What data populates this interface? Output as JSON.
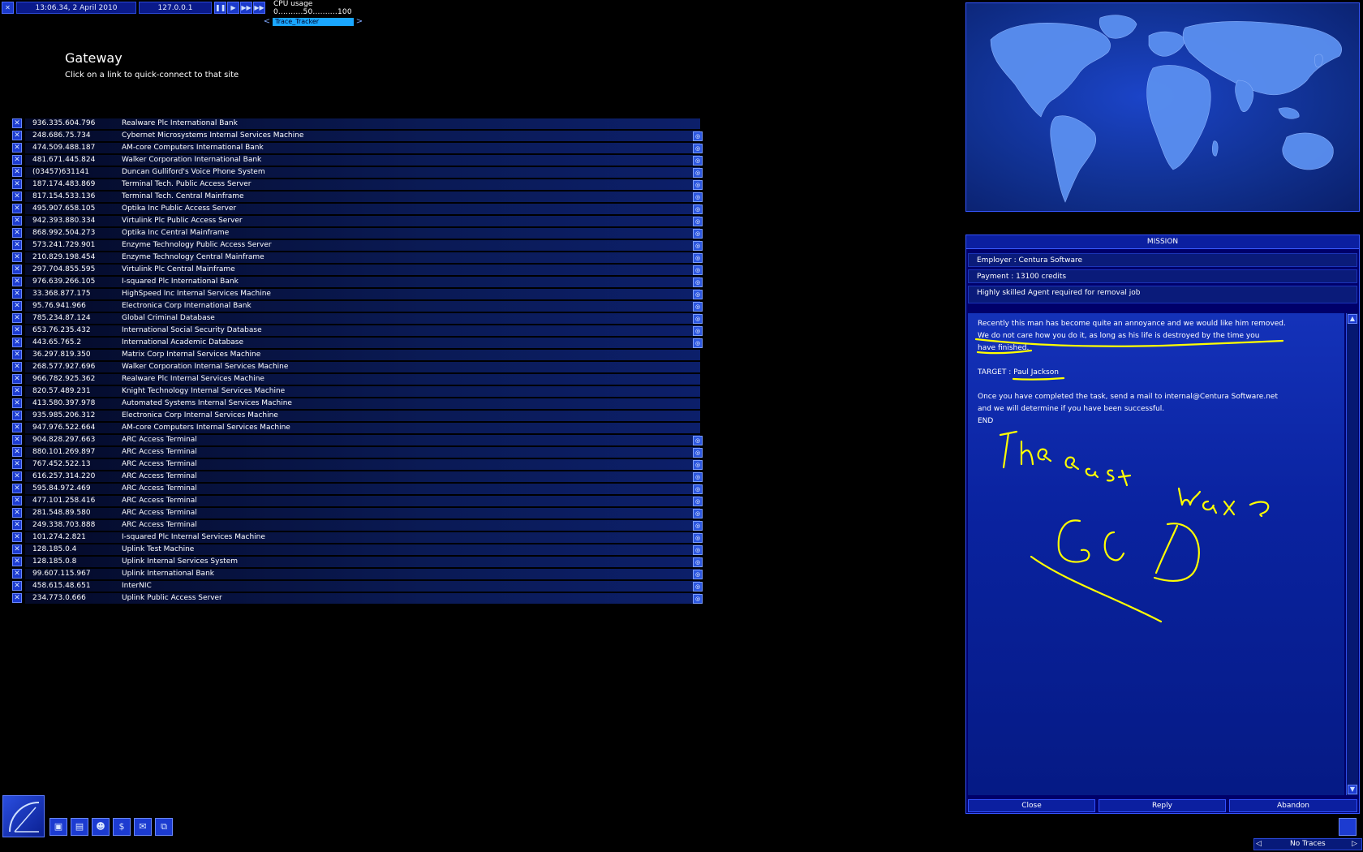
{
  "topbar": {
    "close_icon": "x",
    "datetime": "13:06.34, 2 April 2010",
    "ip": "127.0.0.1",
    "speed_buttons": [
      "pause",
      "play",
      "fast",
      "faster"
    ],
    "cpu_label": "CPU usage",
    "cpu_scale": "0..........50..........100",
    "tracker_name": "Trace_Tracker"
  },
  "gateway": {
    "title": "Gateway",
    "subtitle": "Click on a link to quick-connect to that site"
  },
  "links": [
    {
      "ip": "936.335.604.796",
      "name": "Realware Plc International Bank",
      "bookmark": false
    },
    {
      "ip": "248.686.75.734",
      "name": "Cybernet Microsystems Internal Services Machine",
      "bookmark": true
    },
    {
      "ip": "474.509.488.187",
      "name": "AM-core Computers International Bank",
      "bookmark": true
    },
    {
      "ip": "481.671.445.824",
      "name": "Walker Corporation International Bank",
      "bookmark": true
    },
    {
      "ip": "(03457)631141",
      "name": "Duncan Gulliford's Voice Phone System",
      "bookmark": true
    },
    {
      "ip": "187.174.483.869",
      "name": "Terminal Tech. Public Access Server",
      "bookmark": true
    },
    {
      "ip": "817.154.533.136",
      "name": "Terminal Tech. Central Mainframe",
      "bookmark": true
    },
    {
      "ip": "495.907.658.105",
      "name": "Optika Inc Public Access Server",
      "bookmark": true
    },
    {
      "ip": "942.393.880.334",
      "name": "Virtulink Plc Public Access Server",
      "bookmark": true
    },
    {
      "ip": "868.992.504.273",
      "name": "Optika Inc Central Mainframe",
      "bookmark": true
    },
    {
      "ip": "573.241.729.901",
      "name": "Enzyme Technology Public Access Server",
      "bookmark": true
    },
    {
      "ip": "210.829.198.454",
      "name": "Enzyme Technology Central Mainframe",
      "bookmark": true
    },
    {
      "ip": "297.704.855.595",
      "name": "Virtulink Plc Central Mainframe",
      "bookmark": true
    },
    {
      "ip": "976.639.266.105",
      "name": "I-squared Plc International Bank",
      "bookmark": true
    },
    {
      "ip": "33.368.877.175",
      "name": "HighSpeed Inc Internal Services Machine",
      "bookmark": true
    },
    {
      "ip": "95.76.941.966",
      "name": "Electronica Corp International Bank",
      "bookmark": true
    },
    {
      "ip": "785.234.87.124",
      "name": "Global Criminal Database",
      "bookmark": true
    },
    {
      "ip": "653.76.235.432",
      "name": "International Social Security Database",
      "bookmark": true
    },
    {
      "ip": "443.65.765.2",
      "name": "International Academic Database",
      "bookmark": true
    },
    {
      "ip": "36.297.819.350",
      "name": "Matrix Corp Internal Services Machine",
      "bookmark": false
    },
    {
      "ip": "268.577.927.696",
      "name": "Walker Corporation Internal Services Machine",
      "bookmark": false
    },
    {
      "ip": "966.782.925.362",
      "name": "Realware Plc Internal Services Machine",
      "bookmark": false
    },
    {
      "ip": "820.57.489.231",
      "name": "Knight Technology Internal Services Machine",
      "bookmark": false
    },
    {
      "ip": "413.580.397.978",
      "name": "Automated Systems Internal Services Machine",
      "bookmark": false
    },
    {
      "ip": "935.985.206.312",
      "name": "Electronica Corp Internal Services Machine",
      "bookmark": false
    },
    {
      "ip": "947.976.522.664",
      "name": "AM-core Computers Internal Services Machine",
      "bookmark": false
    },
    {
      "ip": "904.828.297.663",
      "name": "ARC Access Terminal",
      "bookmark": true
    },
    {
      "ip": "880.101.269.897",
      "name": "ARC Access Terminal",
      "bookmark": true
    },
    {
      "ip": "767.452.522.13",
      "name": "ARC Access Terminal",
      "bookmark": true
    },
    {
      "ip": "616.257.314.220",
      "name": "ARC Access Terminal",
      "bookmark": true
    },
    {
      "ip": "595.84.972.469",
      "name": "ARC Access Terminal",
      "bookmark": true
    },
    {
      "ip": "477.101.258.416",
      "name": "ARC Access Terminal",
      "bookmark": true
    },
    {
      "ip": "281.548.89.580",
      "name": "ARC Access Terminal",
      "bookmark": true
    },
    {
      "ip": "249.338.703.888",
      "name": "ARC Access Terminal",
      "bookmark": true
    },
    {
      "ip": "101.274.2.821",
      "name": "I-squared Plc Internal Services Machine",
      "bookmark": true
    },
    {
      "ip": "128.185.0.4",
      "name": "Uplink Test Machine",
      "bookmark": true
    },
    {
      "ip": "128.185.0.8",
      "name": "Uplink Internal Services System",
      "bookmark": true
    },
    {
      "ip": "99.607.115.967",
      "name": "Uplink International Bank",
      "bookmark": true
    },
    {
      "ip": "458.615.48.651",
      "name": "InterNIC",
      "bookmark": true
    },
    {
      "ip": "234.773.0.666",
      "name": "Uplink Public Access Server",
      "bookmark": true
    }
  ],
  "mission": {
    "title": "MISSION",
    "employer": "Employer : Centura Software",
    "payment": "Payment : 13100 credits",
    "summary": "Highly skilled Agent required for removal job",
    "body_line1": "Recently this man has become quite an annoyance and we would like him removed.",
    "body_line2": "We do not care how you do it, as long as his life is destroyed by the time you",
    "body_line3": "have finished.",
    "target": "TARGET : Paul Jackson",
    "contact_line1": "Once you have completed the task, send a mail to internal@Centura Software.net",
    "contact_line2": "and we will determine if you have been successful.",
    "end": "END",
    "buttons": {
      "close": "Close",
      "reply": "Reply",
      "abandon": "Abandon"
    }
  },
  "bottombar": {
    "icons": [
      "computer-icon",
      "disk-icon",
      "people-icon",
      "dollar-icon",
      "mail-icon",
      "network-icon"
    ],
    "dollar_glyph": "$",
    "traces": "No Traces"
  },
  "colors": {
    "accent": "#1c3bd0",
    "panel": "#00006a",
    "handwriting": "#ffff00"
  }
}
